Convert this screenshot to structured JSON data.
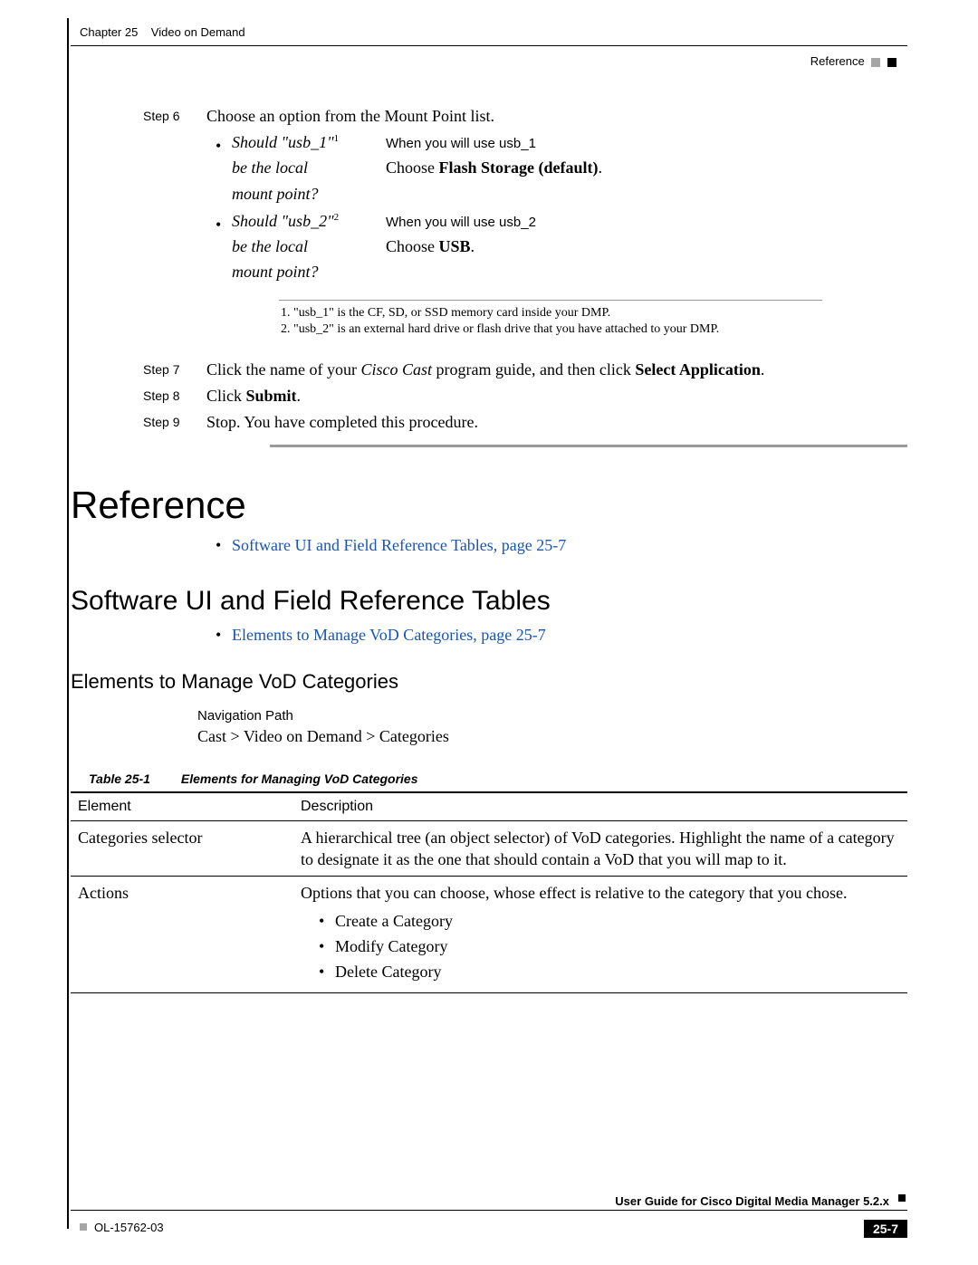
{
  "header": {
    "chapter_label": "Chapter 25",
    "chapter_title": "Video on Demand",
    "section": "Reference"
  },
  "steps": {
    "s6": {
      "label": "Step 6",
      "text": "Choose an option from the Mount Point list."
    },
    "s7": {
      "label": "Step 7",
      "text_pre": "Click the name of your ",
      "text_em": "Cisco Cast",
      "text_mid": " program guide, and then click ",
      "text_bold": "Select Application",
      "text_post": "."
    },
    "s8": {
      "label": "Step 8",
      "text_pre": "Click ",
      "text_bold": "Submit",
      "text_post": "."
    },
    "s9": {
      "label": "Step 9",
      "text": "Stop. You have completed this procedure."
    }
  },
  "mount": {
    "usb1": {
      "q1": "Should \"usb_1\"",
      "sup": "1",
      "q2": "be the local",
      "q3": "mount point?",
      "when": "When you will use usb_1",
      "choose_pre": "Choose ",
      "choose_bold": "Flash Storage (default)",
      "choose_post": "."
    },
    "usb2": {
      "q1": "Should \"usb_2\"",
      "sup": "2",
      "q2": "be the local",
      "q3": "mount point?",
      "when": "When you will use usb_2",
      "choose_pre": "Choose ",
      "choose_bold": "USB",
      "choose_post": "."
    }
  },
  "footnotes": {
    "f1": "1.  \"usb_1\" is the CF, SD, or SSD memory card inside your DMP.",
    "f2": "2.  \"usb_2\" is an external hard drive or flash drive that you have attached to your DMP."
  },
  "reference": {
    "heading": "Reference",
    "link1": "Software UI and Field Reference Tables, page 25-7",
    "sub_heading": "Software UI and Field Reference Tables",
    "link2": "Elements to Manage VoD Categories, page 25-7",
    "sub2_heading": "Elements to Manage VoD Categories",
    "nav_label": "Navigation Path",
    "nav_path": "Cast > Video on Demand > Categories"
  },
  "table": {
    "caption_num": "Table 25-1",
    "caption_title": "Elements for Managing VoD Categories",
    "col1": "Element",
    "col2": "Description",
    "rows": {
      "r1": {
        "elem": "Categories selector",
        "desc": "A hierarchical tree (an object selector) of VoD categories. Highlight the name of a category to designate it as the one that should contain a VoD that you will map to it."
      },
      "r2": {
        "elem": "Actions",
        "desc": "Options that you can choose, whose effect is relative to the category that you chose.",
        "a1": "Create a Category",
        "a2": "Modify Category",
        "a3": "Delete Category"
      }
    }
  },
  "footer": {
    "doc_title": "User Guide for Cisco Digital Media Manager 5.2.x",
    "doc_id": "OL-15762-03",
    "page": "25-7"
  }
}
